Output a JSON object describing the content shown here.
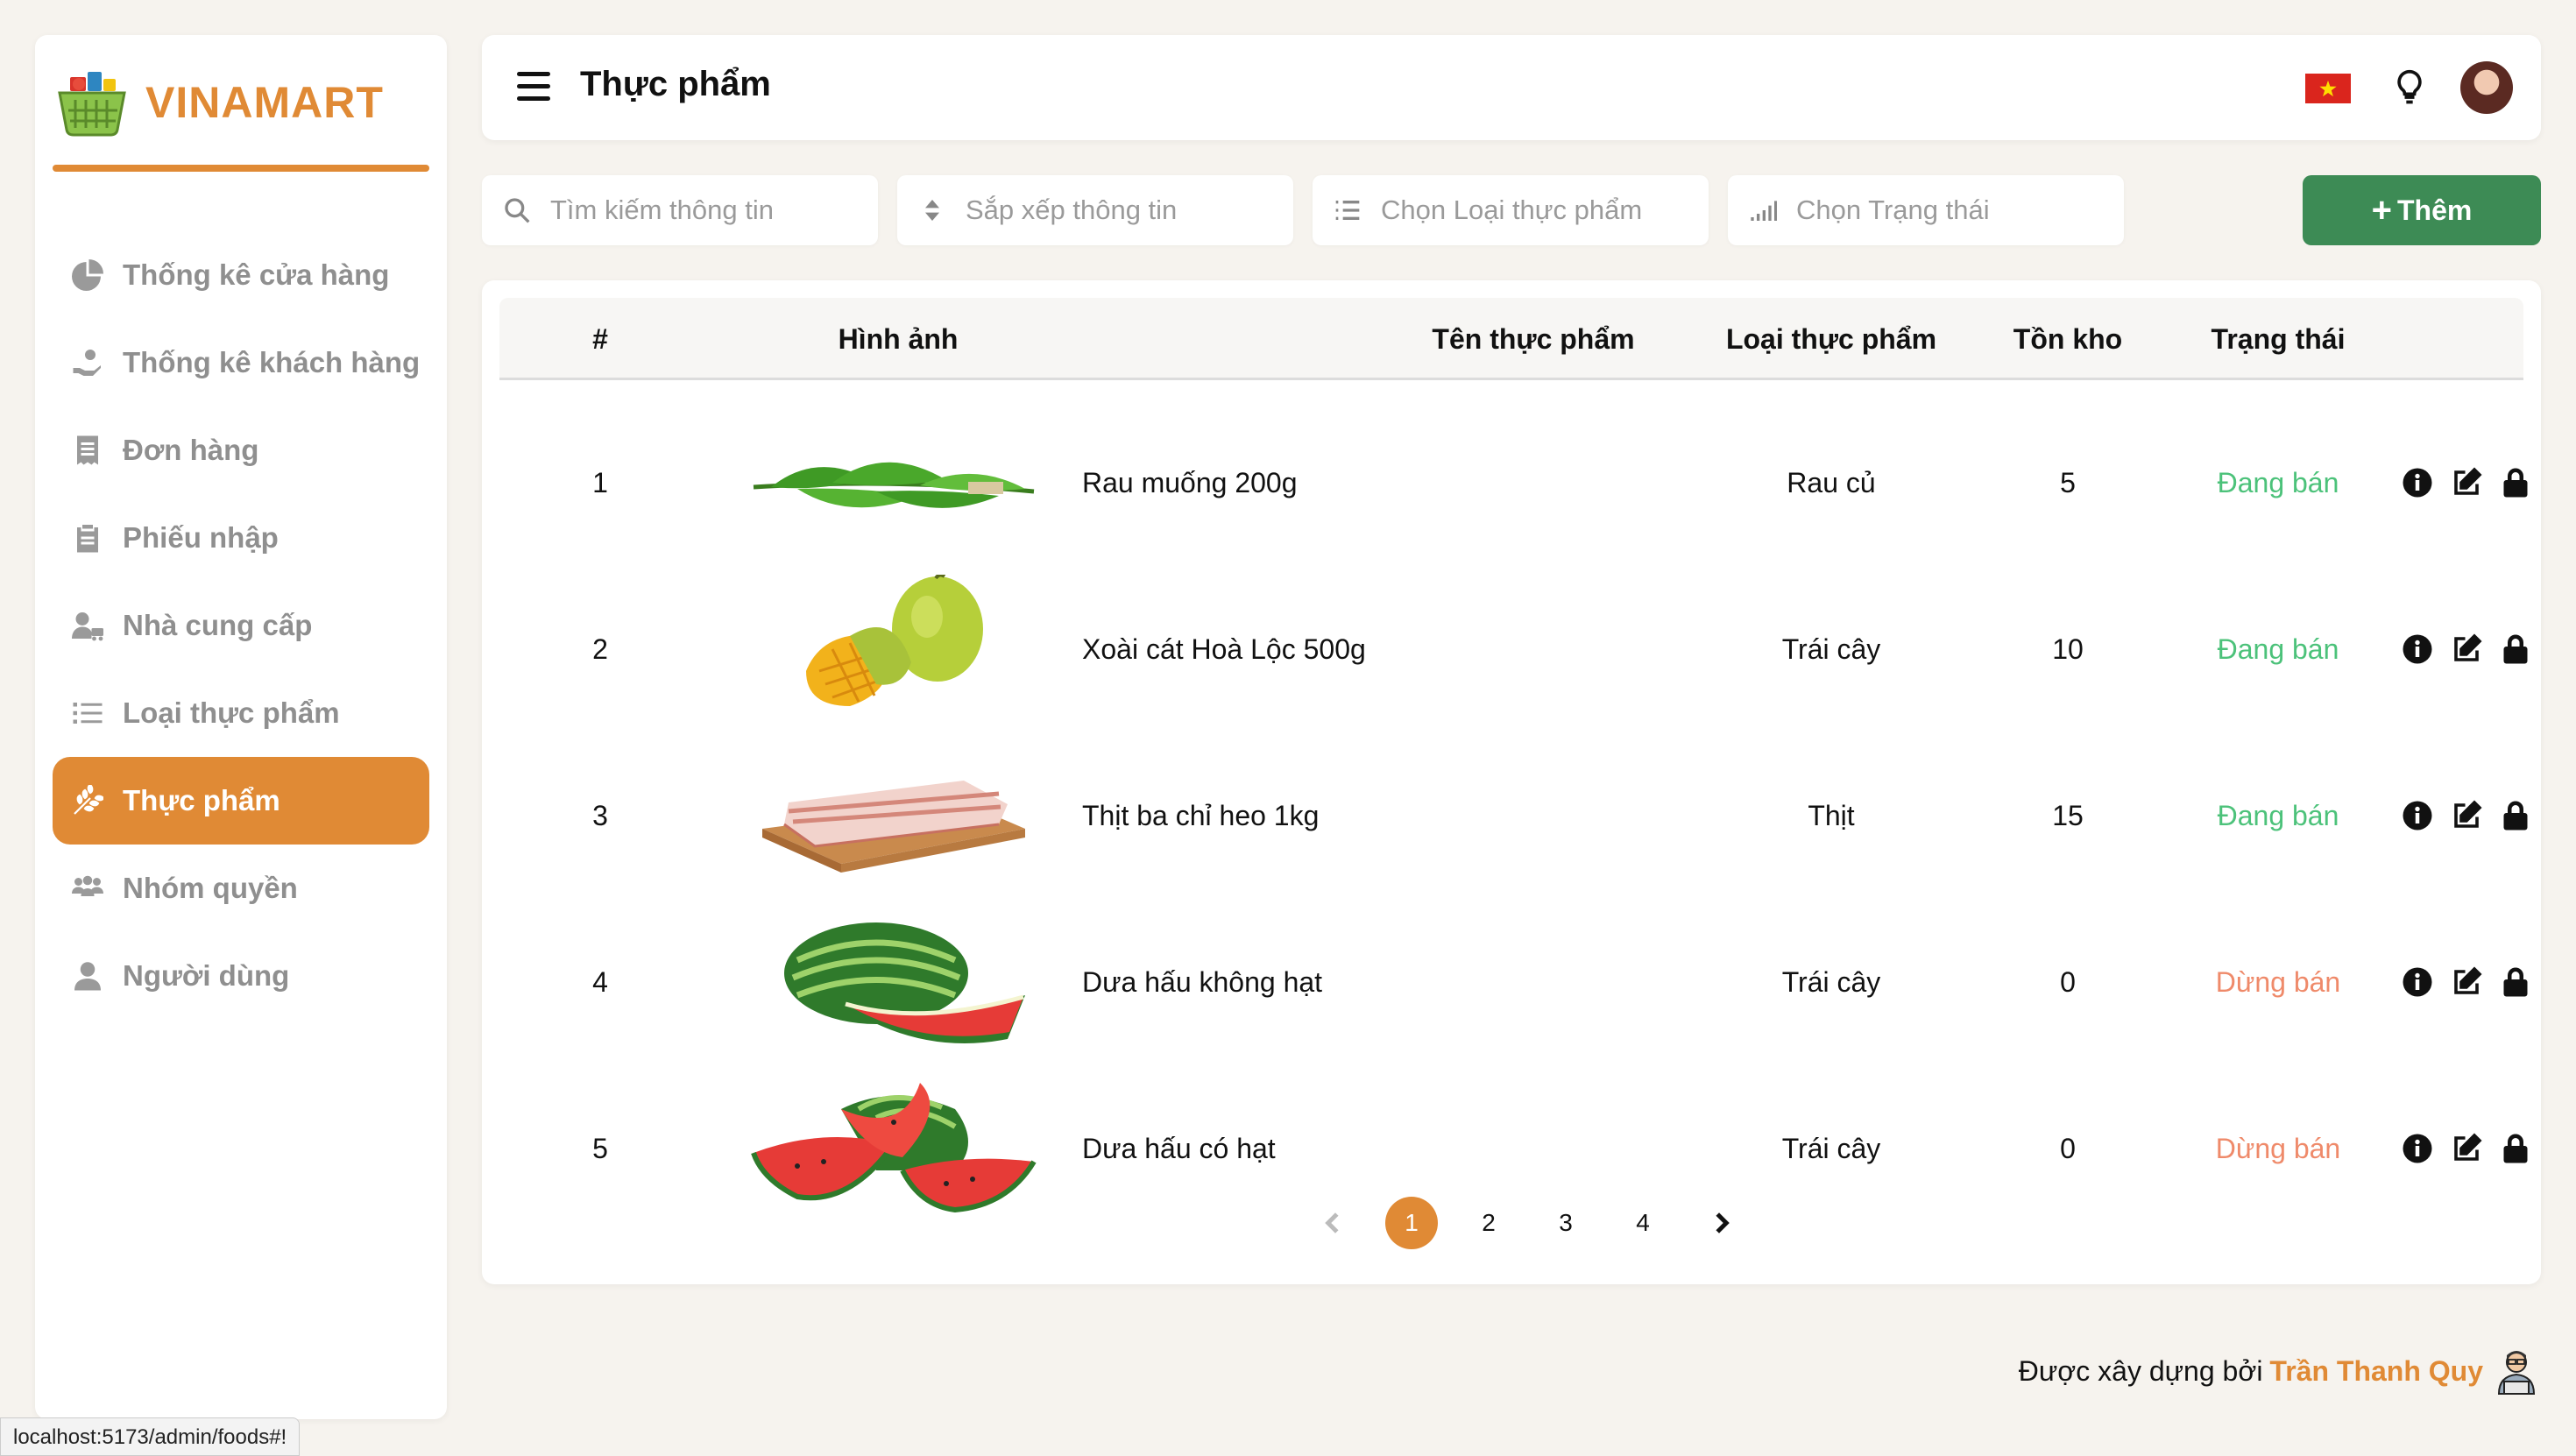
{
  "brand": {
    "name": "VINAMART",
    "accent": "#e08a35"
  },
  "sidebar": {
    "items": [
      {
        "label": "Thống kê cửa hàng",
        "icon": "pie-chart-icon"
      },
      {
        "label": "Thống kê khách hàng",
        "icon": "hand-coin-icon"
      },
      {
        "label": "Đơn hàng",
        "icon": "receipt-icon"
      },
      {
        "label": "Phiếu nhập",
        "icon": "clipboard-icon"
      },
      {
        "label": "Nhà cung cấp",
        "icon": "supplier-icon"
      },
      {
        "label": "Loại thực phẩm",
        "icon": "list-icon"
      },
      {
        "label": "Thực phẩm",
        "icon": "wheat-icon",
        "active": true
      },
      {
        "label": "Nhóm quyền",
        "icon": "group-icon"
      },
      {
        "label": "Người dùng",
        "icon": "user-icon"
      }
    ]
  },
  "header": {
    "title": "Thực phẩm"
  },
  "filters": {
    "search_placeholder": "Tìm kiếm thông tin",
    "sort_placeholder": "Sắp xếp thông tin",
    "category_placeholder": "Chọn Loại thực phẩm",
    "status_placeholder": "Chọn Trạng thái",
    "add_label": "Thêm"
  },
  "table": {
    "headers": [
      "#",
      "Hình ảnh",
      "Tên thực phẩm",
      "Loại thực phẩm",
      "Tồn kho",
      "Trạng thái"
    ],
    "rows": [
      {
        "index": "1",
        "name": "Rau muống 200g",
        "category": "Rau củ",
        "stock": "5",
        "status": "Đang bán",
        "active": true,
        "image": "water-spinach"
      },
      {
        "index": "2",
        "name": "Xoài cát Hoà Lộc 500g",
        "category": "Trái cây",
        "stock": "10",
        "status": "Đang bán",
        "active": true,
        "image": "mango"
      },
      {
        "index": "3",
        "name": "Thịt ba chỉ heo 1kg",
        "category": "Thịt",
        "stock": "15",
        "status": "Đang bán",
        "active": true,
        "image": "pork-belly"
      },
      {
        "index": "4",
        "name": "Dưa hấu không hạt",
        "category": "Trái cây",
        "stock": "0",
        "status": "Dừng bán",
        "active": false,
        "image": "seedless-watermelon"
      },
      {
        "index": "5",
        "name": "Dưa hấu có hạt",
        "category": "Trái cây",
        "stock": "0",
        "status": "Dừng bán",
        "active": false,
        "image": "watermelon"
      }
    ]
  },
  "pagination": {
    "pages": [
      "1",
      "2",
      "3",
      "4"
    ],
    "current": "1"
  },
  "footer": {
    "text": "Được xây dựng bởi",
    "author": "Trần Thanh Quy"
  },
  "status_bar": {
    "url": "localhost:5173/admin/foods#!"
  },
  "colors": {
    "active_status": "#4cc27a",
    "inactive_status": "#ef8a6a",
    "add_button": "#3d8b55",
    "background": "#f6f3ee"
  }
}
